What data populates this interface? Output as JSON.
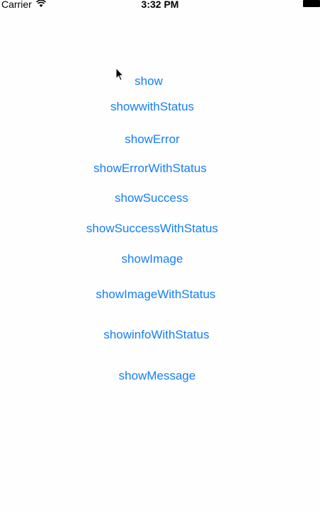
{
  "status_bar": {
    "carrier": "Carrier",
    "time": "3:32 PM",
    "wifi_icon": "wifi-icon",
    "battery_icon": "battery-icon"
  },
  "cursor_icon": "pointer-cursor-icon",
  "colors": {
    "accent": "#147efb",
    "background": "#fefefe",
    "status_text": "#000000"
  },
  "buttons": [
    "show",
    "showwithStatus",
    "showError",
    "showErrorWithStatus",
    "showSuccess",
    "showSuccessWithStatus",
    "showImage",
    "showImageWithStatus",
    "showinfoWithStatus",
    "showMessage"
  ]
}
